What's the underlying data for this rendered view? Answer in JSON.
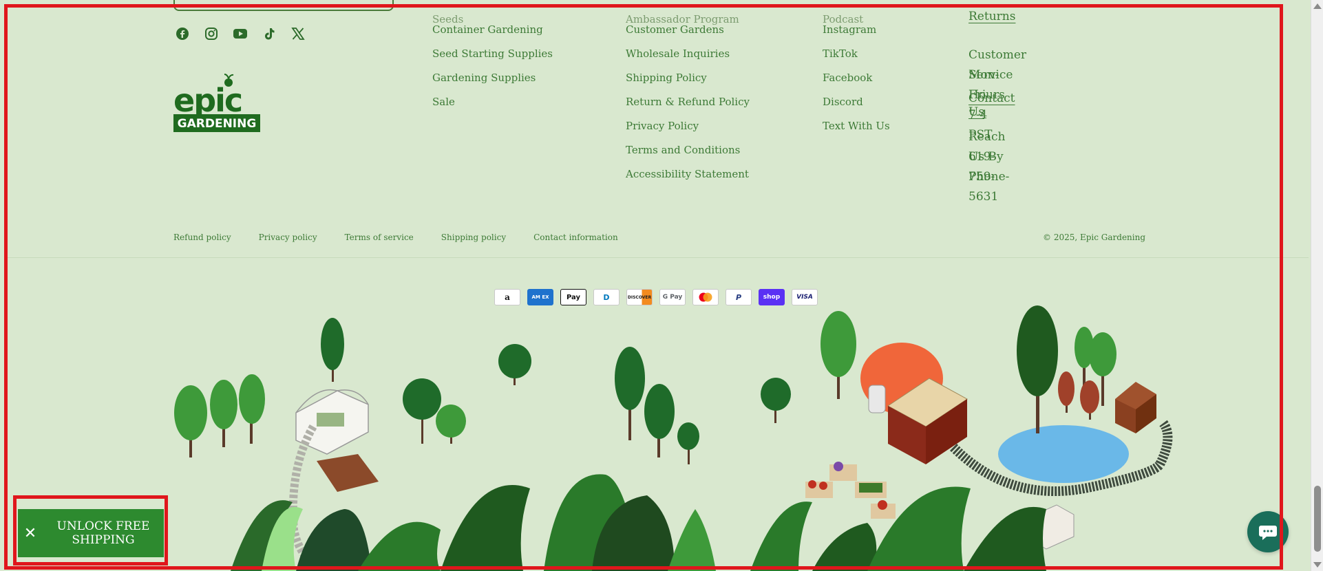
{
  "social": {
    "icons": [
      "facebook-icon",
      "instagram-icon",
      "youtube-icon",
      "tiktok-icon",
      "x-icon"
    ]
  },
  "logo": {
    "line1": "epic",
    "line2": "GARDENING"
  },
  "shop_col": {
    "partial_top": "Seeds",
    "links": [
      "Container Gardening",
      "Seed Starting Supplies",
      "Gardening Supplies",
      "Sale"
    ]
  },
  "info_col": {
    "partial_top": "Ambassador Program",
    "links": [
      "Customer Gardens",
      "Wholesale Inquiries",
      "Shipping Policy",
      "Return & Refund Policy",
      "Privacy Policy",
      "Terms and Conditions",
      "Accessibility Statement"
    ]
  },
  "community_col": {
    "partial_top": "Podcast",
    "links": [
      "Instagram",
      "TikTok",
      "Facebook",
      "Discord",
      "Text With Us"
    ]
  },
  "contact": {
    "returns": "Returns",
    "hours_label": "Customer Service Hours",
    "hours_value": "Mon-Fri 7-4 PST",
    "contact_us": "Contact Us",
    "phone_label": "Reach Us By Phone-",
    "phone_value": "619-759-5631"
  },
  "policies": [
    "Refund policy",
    "Privacy policy",
    "Terms of service",
    "Shipping policy",
    "Contact information"
  ],
  "copyright": "© 2025, Epic Gardening",
  "payments": [
    {
      "name": "amazon",
      "label": "a"
    },
    {
      "name": "american-express",
      "label": "AM EX"
    },
    {
      "name": "apple-pay",
      "label": "Pay"
    },
    {
      "name": "diners-club",
      "label": "D"
    },
    {
      "name": "discover",
      "label": "DISCOVER"
    },
    {
      "name": "google-pay",
      "label": "G Pay"
    },
    {
      "name": "mastercard",
      "label": ""
    },
    {
      "name": "paypal",
      "label": "P"
    },
    {
      "name": "shop-pay",
      "label": "shop"
    },
    {
      "name": "visa",
      "label": "VISA"
    }
  ],
  "shipping_button": {
    "label": "UNLOCK FREE SHIPPING",
    "close": "✕"
  },
  "colors": {
    "background": "#d9e8cf",
    "text": "#3d7a36",
    "accent": "#2d8a2f",
    "frame": "#e0161c",
    "chat": "#1a6e5a"
  }
}
